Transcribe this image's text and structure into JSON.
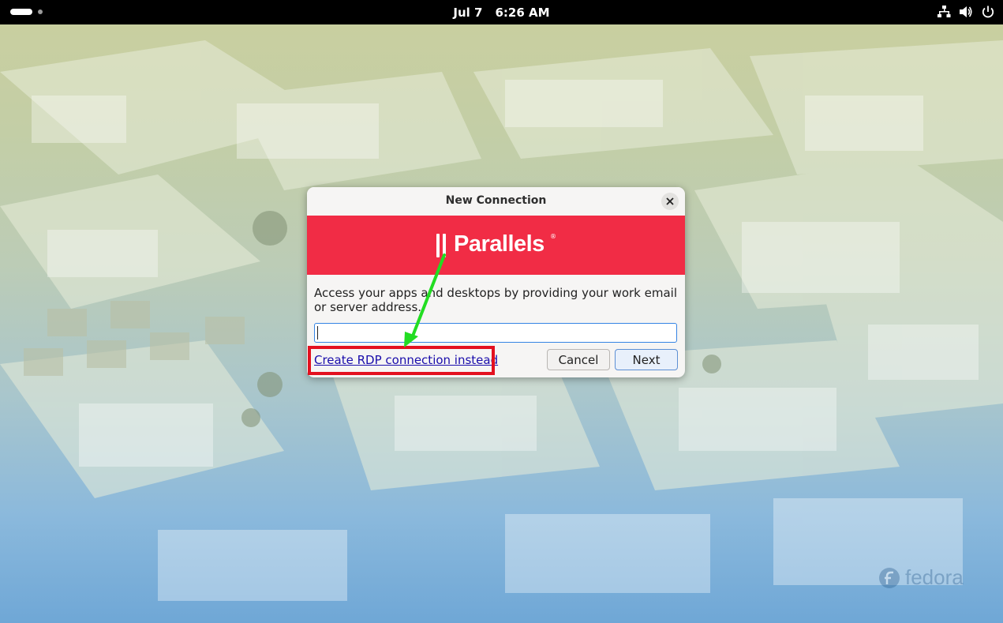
{
  "topbar": {
    "date": "Jul 7",
    "time": "6:26 AM"
  },
  "dialog": {
    "title": "New Connection",
    "banner_color": "#f12c45",
    "brand": "Parallels",
    "brand_mark": "®",
    "instructions": "Access your apps and desktops by providing your work email or server address.",
    "address_value": "",
    "rdp_link": "Create RDP connection instead",
    "cancel_label": "Cancel",
    "next_label": "Next"
  },
  "annotations": {
    "highlight_color": "#e3101f",
    "arrow_color": "#22dd22"
  },
  "wallpaper": {
    "watermark": "fedora"
  },
  "icons": {
    "workspace_indicator": "workspace-icon",
    "network": "network-icon",
    "volume": "volume-icon",
    "power": "power-icon",
    "close": "close-icon",
    "parallels_logo": "parallels-logo-icon"
  }
}
